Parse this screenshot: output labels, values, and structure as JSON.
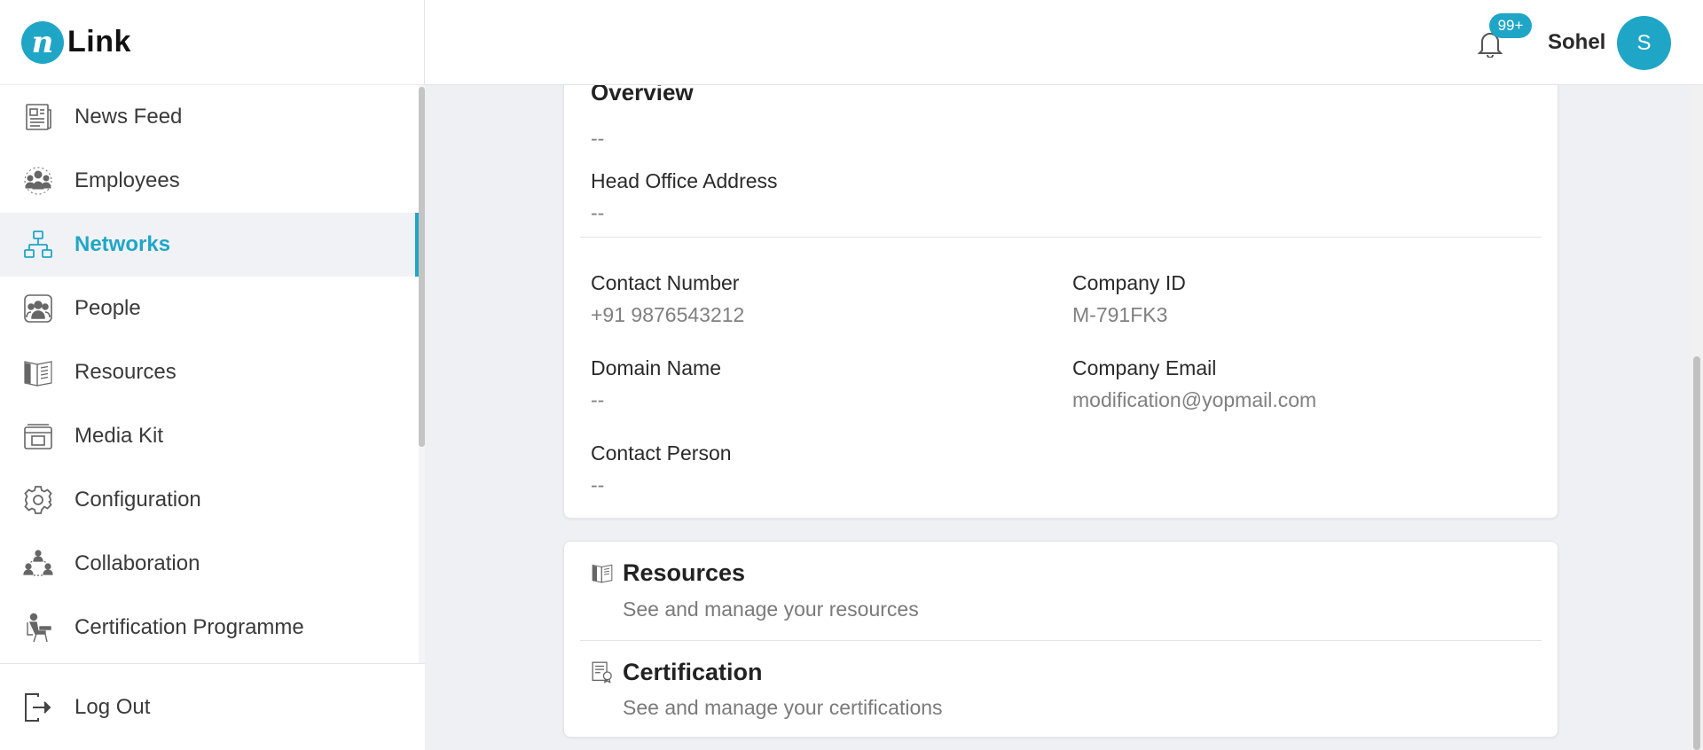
{
  "logo": {
    "mark": "n",
    "text": "Link"
  },
  "sidebar": {
    "items": [
      {
        "label": "News Feed",
        "icon": "news-feed-icon",
        "active": false
      },
      {
        "label": "Employees",
        "icon": "employees-icon",
        "active": false
      },
      {
        "label": "Networks",
        "icon": "networks-icon",
        "active": true
      },
      {
        "label": "People",
        "icon": "people-icon",
        "active": false
      },
      {
        "label": "Resources",
        "icon": "resources-icon",
        "active": false
      },
      {
        "label": "Media Kit",
        "icon": "media-kit-icon",
        "active": false
      },
      {
        "label": "Configuration",
        "icon": "gear-icon",
        "active": false
      },
      {
        "label": "Collaboration",
        "icon": "collaboration-icon",
        "active": false
      },
      {
        "label": "Certification Programme",
        "icon": "certification-programme-icon",
        "active": false
      }
    ],
    "logout": "Log Out"
  },
  "header": {
    "notifications_badge": "99+",
    "username": "Sohel",
    "avatar_initial": "S"
  },
  "company": {
    "overview_label": "Overview",
    "overview_value": "--",
    "head_office_label": "Head Office Address",
    "head_office_value": "--",
    "contact_number_label": "Contact Number",
    "contact_number_value": "+91 9876543212",
    "company_id_label": "Company ID",
    "company_id_value": "M-791FK3",
    "domain_label": "Domain Name",
    "domain_value": "--",
    "email_label": "Company Email",
    "email_value": "modification@yopmail.com",
    "contact_person_label": "Contact Person",
    "contact_person_value": "--"
  },
  "sections": {
    "resources_title": "Resources",
    "resources_sub": "See and manage your resources",
    "certification_title": "Certification",
    "certification_sub": "See and manage your certifications"
  },
  "colors": {
    "accent": "#1fa6c7",
    "background": "#eff0f3"
  }
}
